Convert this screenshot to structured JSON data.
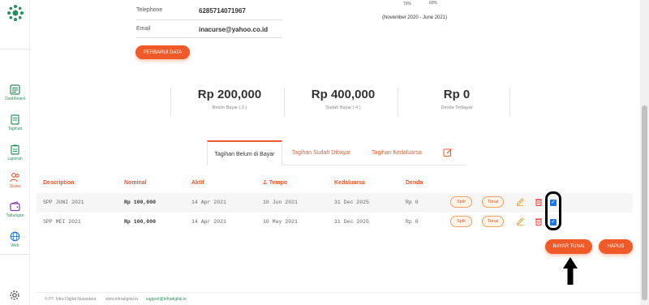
{
  "sidebar": {
    "items": [
      {
        "label": "Dashboard",
        "icon": "dashboard-icon"
      },
      {
        "label": "Tagihan",
        "icon": "bill-icon"
      },
      {
        "label": "Laporan",
        "icon": "report-icon"
      },
      {
        "label": "Siswa",
        "icon": "students-icon"
      },
      {
        "label": "Tabungan",
        "icon": "wallet-icon"
      },
      {
        "label": "Web",
        "icon": "globe-icon"
      }
    ],
    "accent": "#2a8f5f"
  },
  "profile": {
    "telephone_label": "Telephone",
    "telephone_value": "6285714071967",
    "email_label": "Email",
    "email_value": "inacurse@yahoo.co.id",
    "update_button": "PERBARUI DATA"
  },
  "progress": {
    "pct_a": "70%",
    "pct_b": "60%",
    "period": "(November 2020 - June 2021)"
  },
  "stats": [
    {
      "amount": "Rp 200,000",
      "label": "Belum Bayar ( 2 )"
    },
    {
      "amount": "Rp 400,000",
      "label": "Sudah Bayar ( 4 )"
    },
    {
      "amount": "Rp 0",
      "label": "Denda Terbayar"
    }
  ],
  "tabs": [
    {
      "label": "Tagihan Belum di Bayar",
      "active": true
    },
    {
      "label": "Tagihan Sudah Dibayar",
      "active": false
    },
    {
      "label": "Tagihan Kedaluarsa",
      "active": false
    }
  ],
  "table": {
    "headers": [
      "Description",
      "Nominal",
      "Aktif",
      "J. Tempo",
      "Kedaluarsa",
      "Denda"
    ],
    "rows": [
      {
        "description": "SPP JUNI 2021",
        "nominal": "Rp 100,000",
        "aktif": "14 Apr 2021",
        "tempo": "10 Jun 2021",
        "kedaluarsa": "31 Dec 2025",
        "denda": "Rp 0",
        "split": "Split",
        "tunai": "Tunai",
        "checked": true
      },
      {
        "description": "SPP MEI 2021",
        "nominal": "Rp 100,000",
        "aktif": "14 Apr 2021",
        "tempo": "10 May 2021",
        "kedaluarsa": "31 Dec 2025",
        "denda": "Rp 0",
        "split": "Split",
        "tunai": "Tunai",
        "checked": true
      }
    ]
  },
  "actions": {
    "pay_cash": "BAYAR TUNAI",
    "delete": "HAPUS"
  },
  "footer": {
    "company": "© PT. Infra Digital Nusantara",
    "website": "www.infradigital.io",
    "support": "support@infradigital.io"
  },
  "colors": {
    "primary": "#f05a28",
    "checkbox": "#1a73e8"
  }
}
